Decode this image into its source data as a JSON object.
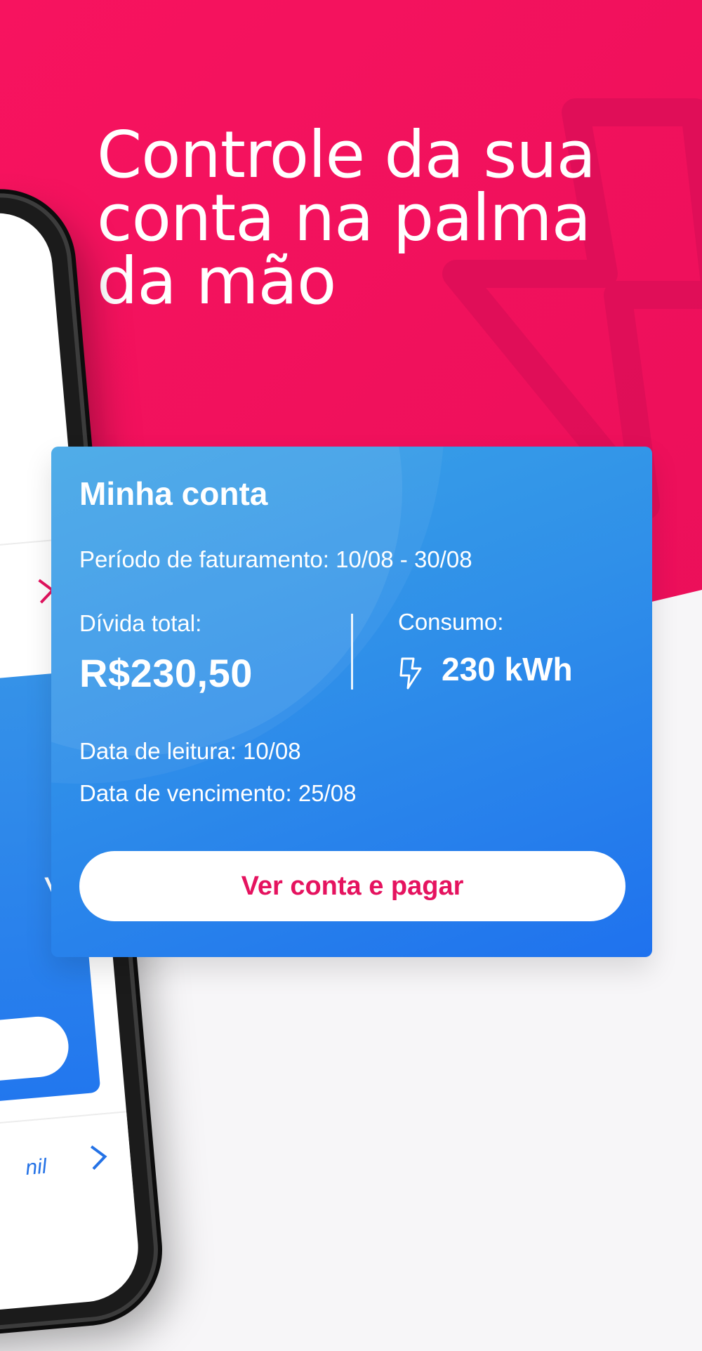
{
  "colors": {
    "brand_pink": "#f21460",
    "card_blue_start": "#3aa3e6",
    "card_blue_end": "#1f72ee",
    "button_text": "#e5135f"
  },
  "hero": {
    "headline_lines": [
      "Controle da sua",
      "conta na palma",
      "da mão"
    ]
  },
  "card": {
    "title": "Minha conta",
    "period": "Período de faturamento: 10/08 - 30/08",
    "debt_label": "Dívida total:",
    "debt_value": "R$230,50",
    "consumption_label": "Consumo:",
    "consumption_icon": "lightning-bolt-icon",
    "consumption_value": "230 kWh",
    "reading_date": "Data de leitura: 10/08",
    "due_date": "Data de vencimento: 25/08",
    "action_label": "Ver conta e pagar"
  },
  "phone": {
    "card_partial_text": "Vh",
    "bottom_partial_text": "nil"
  }
}
